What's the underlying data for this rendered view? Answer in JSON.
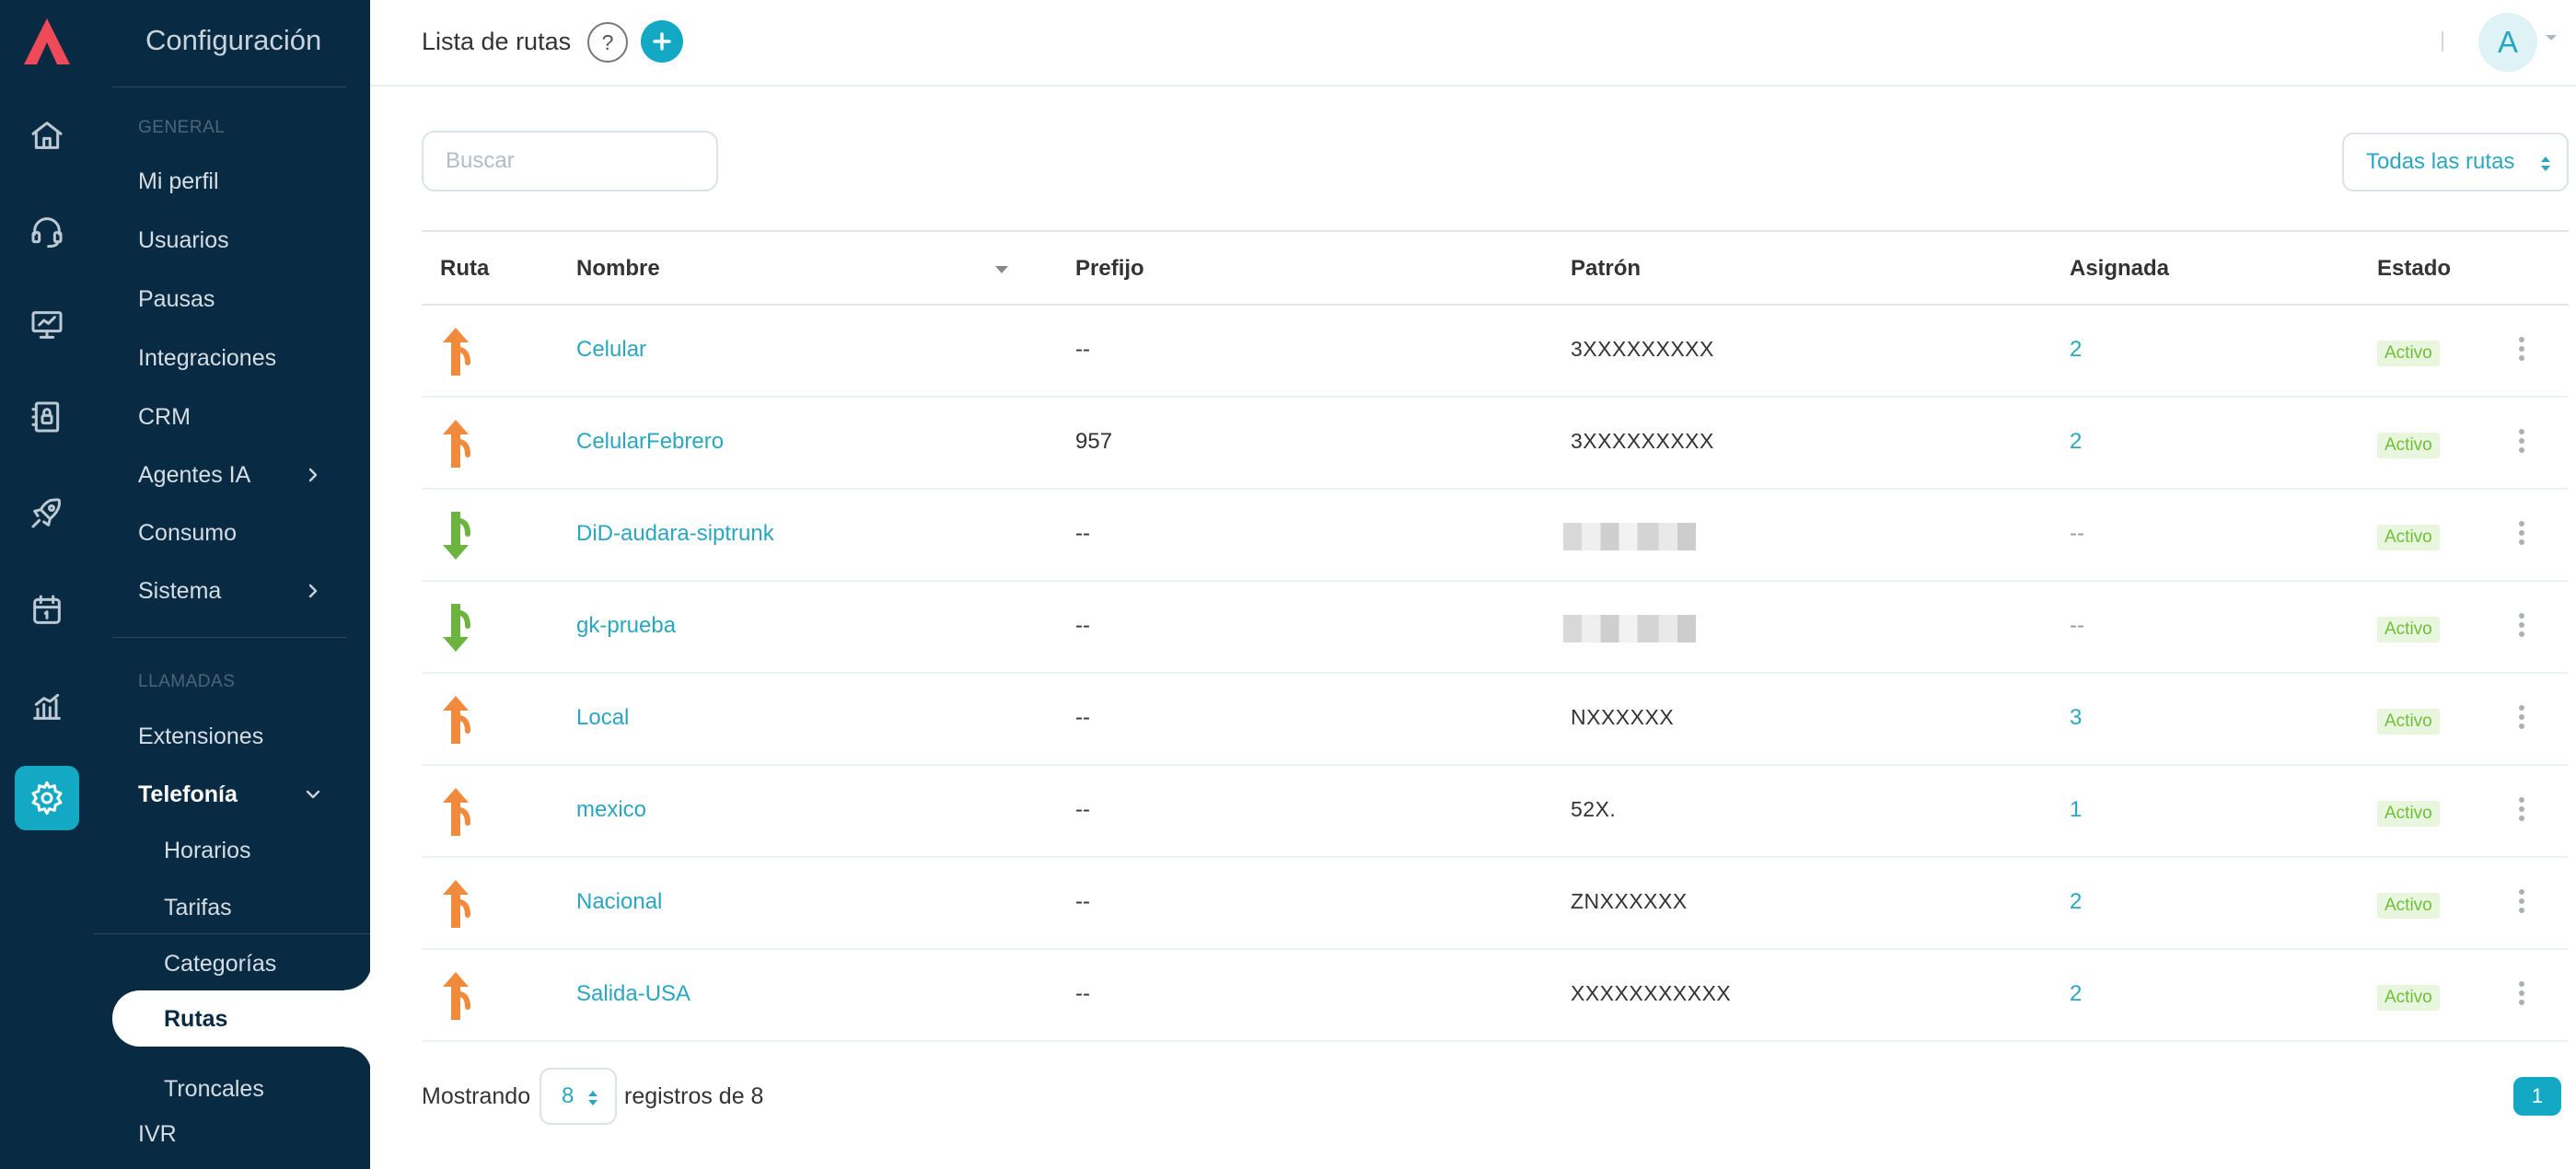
{
  "colors": {
    "rail_bg": "#082a43",
    "accent": "#13a9c4",
    "link": "#2aa7c0",
    "outbound": "#f08a3c",
    "inbound": "#6db33f",
    "badge_bg": "#e7f6dc",
    "badge_text": "#6fbf3b"
  },
  "rail": {
    "icons": [
      "logo-icon",
      "home-icon",
      "headset-icon",
      "monitor-icon",
      "phonebook-icon",
      "rocket-icon",
      "calendar-icon",
      "chart-icon",
      "gear-icon"
    ]
  },
  "sidebar": {
    "title": "Configuración",
    "general_label": "GENERAL",
    "general_items": [
      "Mi perfil",
      "Usuarios",
      "Pausas",
      "Integraciones",
      "CRM",
      "Agentes IA",
      "Consumo",
      "Sistema"
    ],
    "calls_label": "LLAMADAS",
    "extensions": "Extensiones",
    "telephony": "Telefonía",
    "telephony_items": [
      "Horarios",
      "Tarifas",
      "Categorías",
      "Rutas",
      "Troncales"
    ],
    "ivr": "IVR"
  },
  "header": {
    "title": "Lista de rutas",
    "help": "?",
    "avatar": "A"
  },
  "toolbar": {
    "search_placeholder": "Buscar",
    "filter_label": "Todas las rutas"
  },
  "table": {
    "columns": [
      "Ruta",
      "Nombre",
      "Prefijo",
      "Patrón",
      "Asignada",
      "Estado"
    ],
    "rows": [
      {
        "direction": "outbound",
        "name": "Celular",
        "prefix": "--",
        "pattern": "3XXXXXXXXX",
        "assigned": "2",
        "status": "Activo"
      },
      {
        "direction": "outbound",
        "name": "CelularFebrero",
        "prefix": "957",
        "pattern": "3XXXXXXXXX",
        "assigned": "2",
        "status": "Activo"
      },
      {
        "direction": "inbound",
        "name": "DiD-audara-siptrunk",
        "prefix": "--",
        "pattern": "",
        "assigned": "--",
        "status": "Activo"
      },
      {
        "direction": "inbound",
        "name": "gk-prueba",
        "prefix": "--",
        "pattern": "",
        "assigned": "--",
        "status": "Activo"
      },
      {
        "direction": "outbound",
        "name": "Local",
        "prefix": "--",
        "pattern": "NXXXXXX",
        "assigned": "3",
        "status": "Activo"
      },
      {
        "direction": "outbound",
        "name": "mexico",
        "prefix": "--",
        "pattern": "52X.",
        "assigned": "1",
        "status": "Activo"
      },
      {
        "direction": "outbound",
        "name": "Nacional",
        "prefix": "--",
        "pattern": "ZNXXXXXX",
        "assigned": "2",
        "status": "Activo"
      },
      {
        "direction": "outbound",
        "name": "Salida-USA",
        "prefix": "--",
        "pattern": "XXXXXXXXXXX",
        "assigned": "2",
        "status": "Activo"
      }
    ]
  },
  "footer": {
    "showing": "Mostrando",
    "page_size": "8",
    "records": "registros de 8",
    "page": "1"
  }
}
